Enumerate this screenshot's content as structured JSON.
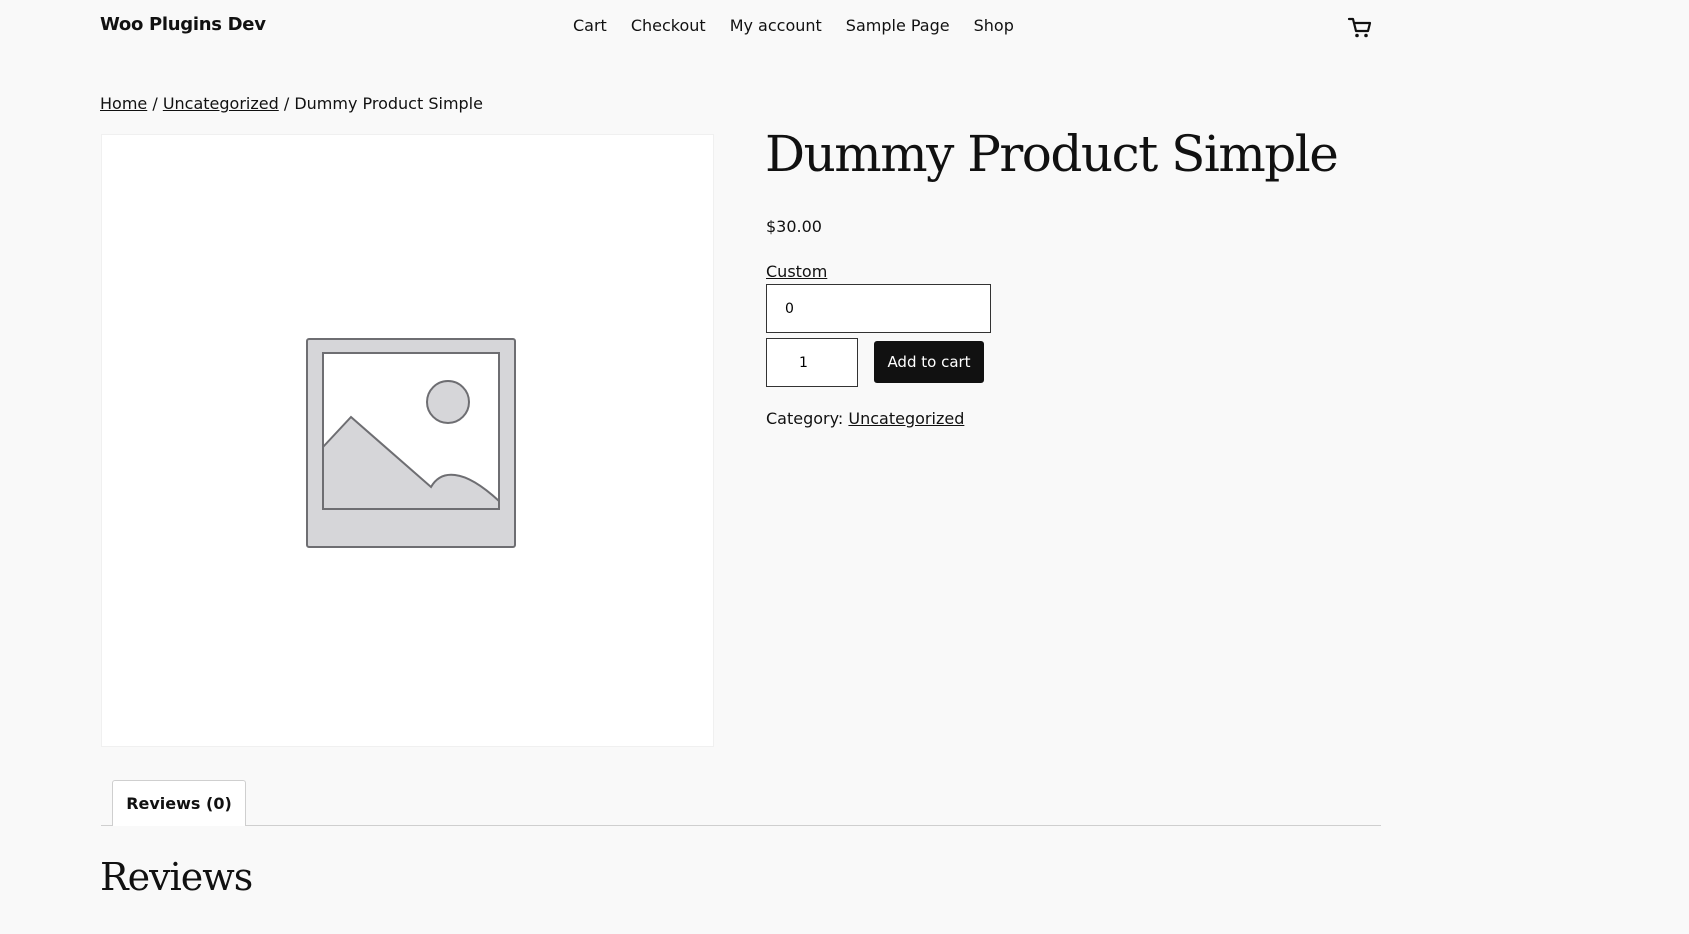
{
  "site": {
    "title": "Woo Plugins Dev"
  },
  "nav": {
    "items": [
      "Cart",
      "Checkout",
      "My account",
      "Sample Page",
      "Shop"
    ]
  },
  "breadcrumb": {
    "home": "Home",
    "sep1": " / ",
    "category": "Uncategorized",
    "sep2": " / ",
    "current": "Dummy Product Simple"
  },
  "product": {
    "title": "Dummy Product Simple",
    "price": "$30.00",
    "custom_label": "Custom",
    "custom_value": "0",
    "quantity": "1",
    "add_to_cart_label": "Add to cart",
    "category_prefix": "Category: ",
    "category": "Uncategorized"
  },
  "tabs": {
    "reviews_label": "Reviews (0)"
  },
  "reviews": {
    "heading": "Reviews"
  },
  "colors": {
    "background": "#f9f9f9",
    "text": "#111111",
    "button": "#111111",
    "placeholder_gray": "#d6d6d9"
  },
  "icons": {
    "cart": "cart-icon",
    "placeholder": "image-placeholder-icon"
  }
}
